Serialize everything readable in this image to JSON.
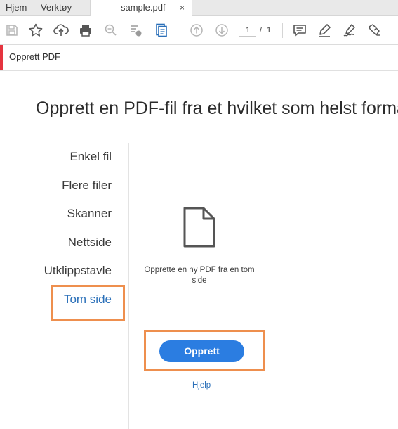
{
  "tabs": {
    "home": "Hjem",
    "tools": "Verktøy",
    "document": "sample.pdf",
    "close": "×"
  },
  "toolbar": {
    "icons": [
      "save-icon",
      "star-icon",
      "cloud-upload-icon",
      "print-icon",
      "zoom-icon",
      "scan-icon",
      "clipboard-icon",
      "page-up-icon",
      "page-down-icon",
      "comment-icon",
      "highlight-icon",
      "sign-icon",
      "fill-sign-icon"
    ],
    "page_current": "1",
    "page_separator": "/",
    "page_total": "1"
  },
  "title_bar": {
    "label": "Opprett PDF"
  },
  "heading": "Opprett en PDF-fil fra et hvilket som helst format",
  "menu": {
    "items": [
      "Enkel fil",
      "Flere filer",
      "Skanner",
      "Nettside",
      "Utklippstavle",
      "Tom side"
    ],
    "selected": "Tom side"
  },
  "content": {
    "description": "Opprette en ny PDF fra en tom side",
    "create_button": "Opprett",
    "help_link": "Hjelp"
  },
  "colors": {
    "accent_red": "#e5343f",
    "button_blue": "#2b7de1",
    "link_blue": "#2b70b9",
    "highlight_orange": "#ee8f4e"
  }
}
